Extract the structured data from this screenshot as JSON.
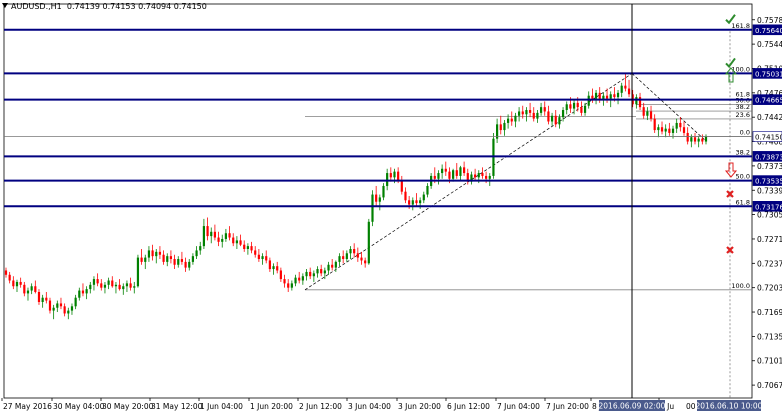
{
  "header": {
    "symbol": "AUDUSD.,H1",
    "ohlc": "0.74139 0.74153 0.74094 0.74150"
  },
  "colors": {
    "bull": "#008000",
    "bear": "#ff0000",
    "level_line": "#000080",
    "grid": "#000000",
    "cursor_label_bg": "#4a5a8c"
  },
  "cursor": {
    "x_label": "2016.06.09 02:00",
    "x_label_right": "2016.06.10 10:00"
  },
  "icons": [
    "check-icon",
    "check-icon",
    "up-arrow-icon",
    "down-arrow-icon",
    "cross-icon",
    "cross-icon"
  ],
  "chart_data": {
    "type": "candlestick",
    "ylim": [
      0.705,
      0.76
    ],
    "y_ticks": [
      "0.75780",
      "0.75440",
      "0.75100",
      "0.74760",
      "0.74420",
      "0.74080",
      "0.73730",
      "0.73390",
      "0.73050",
      "0.72710",
      "0.72370",
      "0.72030",
      "0.71690",
      "0.71350",
      "0.71010",
      "0.70670"
    ],
    "x_ticks": [
      "27 May 2016",
      "30 May 04:00",
      "30 May 20:00",
      "31 May 12:00",
      "1 Jun 04:00",
      "1 Jun 20:00",
      "2 Jun 12:00",
      "3 Jun 04:00",
      "3 Jun 20:00",
      "6 Jun 12:00",
      "7 Jun 04:00",
      "7 Jun 20:00",
      "8 Ju",
      "9 Ju"
    ],
    "x_label_text": "00",
    "price_levels": [
      {
        "label": "0.75640",
        "value": 0.7564
      },
      {
        "label": "0.75031",
        "value": 0.75031
      },
      {
        "label": "0.74665",
        "value": 0.74665
      },
      {
        "label": "0.74150",
        "value": 0.7415
      },
      {
        "label": "0.73873",
        "value": 0.73873
      },
      {
        "label": "0.73535",
        "value": 0.73535
      },
      {
        "label": "0.73176",
        "value": 0.73176
      }
    ],
    "fibo_big": [
      {
        "label": "161.8",
        "value": 0.7564
      },
      {
        "label": "100.0",
        "value": 0.75031
      },
      {
        "label": "61.8",
        "value": 0.74665
      },
      {
        "label": "100.0",
        "value": 0.7201
      }
    ],
    "fibo_small": [
      {
        "label": "50.0",
        "value": 0.74595
      },
      {
        "label": "38.2",
        "value": 0.74505
      },
      {
        "label": "23.6",
        "value": 0.74395
      },
      {
        "label": "0.0",
        "value": 0.7415
      },
      {
        "label": "38.2",
        "value": 0.73873
      },
      {
        "label": "50.0",
        "value": 0.73535
      },
      {
        "label": "61.8",
        "value": 0.73176
      }
    ],
    "ohlc": [
      [
        0.7228,
        0.7232,
        0.7218,
        0.7222
      ],
      [
        0.7222,
        0.7226,
        0.721,
        0.7214
      ],
      [
        0.7214,
        0.722,
        0.7202,
        0.7206
      ],
      [
        0.7206,
        0.7215,
        0.7198,
        0.7212
      ],
      [
        0.7212,
        0.7218,
        0.7204,
        0.7208
      ],
      [
        0.7208,
        0.7212,
        0.7192,
        0.7196
      ],
      [
        0.7196,
        0.7204,
        0.7186,
        0.72
      ],
      [
        0.72,
        0.721,
        0.7195,
        0.7206
      ],
      [
        0.7206,
        0.7214,
        0.7196,
        0.7198
      ],
      [
        0.7198,
        0.7202,
        0.718,
        0.7184
      ],
      [
        0.7184,
        0.7194,
        0.7176,
        0.719
      ],
      [
        0.719,
        0.7198,
        0.7182,
        0.7186
      ],
      [
        0.7186,
        0.719,
        0.7168,
        0.7172
      ],
      [
        0.7172,
        0.718,
        0.716,
        0.7176
      ],
      [
        0.7176,
        0.7186,
        0.717,
        0.7182
      ],
      [
        0.7182,
        0.719,
        0.7174,
        0.7178
      ],
      [
        0.7178,
        0.7182,
        0.7164,
        0.7168
      ],
      [
        0.7168,
        0.7176,
        0.716,
        0.7172
      ],
      [
        0.7172,
        0.7182,
        0.7166,
        0.7178
      ],
      [
        0.7178,
        0.7194,
        0.7174,
        0.719
      ],
      [
        0.719,
        0.7204,
        0.7186,
        0.72
      ],
      [
        0.72,
        0.721,
        0.7192,
        0.7196
      ],
      [
        0.7196,
        0.7206,
        0.7188,
        0.7202
      ],
      [
        0.7202,
        0.7212,
        0.7196,
        0.7208
      ],
      [
        0.7208,
        0.722,
        0.72,
        0.7216
      ],
      [
        0.7216,
        0.7224,
        0.7206,
        0.721
      ],
      [
        0.721,
        0.7216,
        0.72,
        0.7204
      ],
      [
        0.7204,
        0.7212,
        0.7196,
        0.7208
      ],
      [
        0.7208,
        0.7218,
        0.7202,
        0.7214
      ],
      [
        0.7214,
        0.722,
        0.7204,
        0.7206
      ],
      [
        0.7206,
        0.7212,
        0.7196,
        0.7208
      ],
      [
        0.7208,
        0.7216,
        0.72,
        0.7202
      ],
      [
        0.7202,
        0.721,
        0.7194,
        0.7206
      ],
      [
        0.7206,
        0.7214,
        0.7198,
        0.721
      ],
      [
        0.721,
        0.7218,
        0.72,
        0.7204
      ],
      [
        0.7204,
        0.7212,
        0.7196,
        0.7206
      ],
      [
        0.7206,
        0.725,
        0.7204,
        0.7246
      ],
      [
        0.7246,
        0.7258,
        0.7236,
        0.724
      ],
      [
        0.724,
        0.725,
        0.723,
        0.7246
      ],
      [
        0.7246,
        0.7262,
        0.724,
        0.7256
      ],
      [
        0.7256,
        0.7264,
        0.7242,
        0.7248
      ],
      [
        0.7248,
        0.7258,
        0.7238,
        0.7254
      ],
      [
        0.7254,
        0.7262,
        0.7244,
        0.725
      ],
      [
        0.725,
        0.7256,
        0.7236,
        0.724
      ],
      [
        0.724,
        0.7252,
        0.7234,
        0.7248
      ],
      [
        0.7248,
        0.7256,
        0.7238,
        0.7244
      ],
      [
        0.7244,
        0.725,
        0.723,
        0.7236
      ],
      [
        0.7236,
        0.7248,
        0.7232,
        0.7244
      ],
      [
        0.7244,
        0.7254,
        0.7236,
        0.724
      ],
      [
        0.724,
        0.7246,
        0.7226,
        0.7232
      ],
      [
        0.7232,
        0.7244,
        0.7228,
        0.724
      ],
      [
        0.724,
        0.7252,
        0.7236,
        0.7248
      ],
      [
        0.7248,
        0.7262,
        0.7244,
        0.7256
      ],
      [
        0.7256,
        0.7268,
        0.725,
        0.7262
      ],
      [
        0.7262,
        0.73,
        0.7258,
        0.729
      ],
      [
        0.729,
        0.7302,
        0.727,
        0.7276
      ],
      [
        0.7276,
        0.7288,
        0.7266,
        0.7282
      ],
      [
        0.7282,
        0.7292,
        0.727,
        0.7274
      ],
      [
        0.7274,
        0.7282,
        0.7262,
        0.7268
      ],
      [
        0.7268,
        0.7278,
        0.726,
        0.7272
      ],
      [
        0.7272,
        0.7286,
        0.7268,
        0.728
      ],
      [
        0.728,
        0.729,
        0.727,
        0.7274
      ],
      [
        0.7274,
        0.728,
        0.7262,
        0.7266
      ],
      [
        0.7266,
        0.7276,
        0.7258,
        0.727
      ],
      [
        0.727,
        0.7278,
        0.7262,
        0.7264
      ],
      [
        0.7264,
        0.727,
        0.7254,
        0.7258
      ],
      [
        0.7258,
        0.7266,
        0.725,
        0.7262
      ],
      [
        0.7262,
        0.7268,
        0.7252,
        0.7256
      ],
      [
        0.7256,
        0.7262,
        0.7246,
        0.725
      ],
      [
        0.725,
        0.7258,
        0.724,
        0.7244
      ],
      [
        0.7244,
        0.7252,
        0.7236,
        0.7248
      ],
      [
        0.7248,
        0.7256,
        0.7238,
        0.7242
      ],
      [
        0.7242,
        0.7246,
        0.7226,
        0.723
      ],
      [
        0.723,
        0.7238,
        0.7222,
        0.7234
      ],
      [
        0.7234,
        0.724,
        0.7224,
        0.7228
      ],
      [
        0.7228,
        0.7232,
        0.7212,
        0.7216
      ],
      [
        0.7216,
        0.7222,
        0.7204,
        0.721
      ],
      [
        0.721,
        0.7216,
        0.7198,
        0.7204
      ],
      [
        0.7204,
        0.7214,
        0.72,
        0.721
      ],
      [
        0.721,
        0.7222,
        0.7206,
        0.7218
      ],
      [
        0.7218,
        0.7226,
        0.721,
        0.7214
      ],
      [
        0.7214,
        0.7224,
        0.7208,
        0.722
      ],
      [
        0.722,
        0.723,
        0.7214,
        0.7226
      ],
      [
        0.7226,
        0.7232,
        0.7216,
        0.722
      ],
      [
        0.722,
        0.7228,
        0.7212,
        0.7224
      ],
      [
        0.7224,
        0.7234,
        0.7218,
        0.723
      ],
      [
        0.723,
        0.7236,
        0.722,
        0.7224
      ],
      [
        0.7224,
        0.7232,
        0.7216,
        0.7228
      ],
      [
        0.7228,
        0.724,
        0.7222,
        0.7236
      ],
      [
        0.7236,
        0.7244,
        0.7228,
        0.7232
      ],
      [
        0.7232,
        0.7242,
        0.7226,
        0.724
      ],
      [
        0.724,
        0.7252,
        0.7234,
        0.7248
      ],
      [
        0.7248,
        0.7256,
        0.7238,
        0.7244
      ],
      [
        0.7244,
        0.7256,
        0.724,
        0.7252
      ],
      [
        0.7252,
        0.7262,
        0.7244,
        0.7258
      ],
      [
        0.7258,
        0.7266,
        0.7246,
        0.7252
      ],
      [
        0.7252,
        0.726,
        0.724,
        0.7246
      ],
      [
        0.7246,
        0.7254,
        0.7236,
        0.7242
      ],
      [
        0.7242,
        0.7246,
        0.7232,
        0.7238
      ],
      [
        0.7238,
        0.73,
        0.7236,
        0.7296
      ],
      [
        0.7296,
        0.734,
        0.729,
        0.7334
      ],
      [
        0.7334,
        0.7346,
        0.7318,
        0.7324
      ],
      [
        0.7324,
        0.7334,
        0.7312,
        0.733
      ],
      [
        0.733,
        0.735,
        0.7326,
        0.7346
      ],
      [
        0.7346,
        0.737,
        0.734,
        0.7364
      ],
      [
        0.7364,
        0.7372,
        0.7352,
        0.7358
      ],
      [
        0.7358,
        0.737,
        0.735,
        0.7366
      ],
      [
        0.7366,
        0.7372,
        0.735,
        0.7354
      ],
      [
        0.7354,
        0.736,
        0.7334,
        0.7338
      ],
      [
        0.7338,
        0.7344,
        0.7322,
        0.7326
      ],
      [
        0.7326,
        0.7332,
        0.7314,
        0.732
      ],
      [
        0.732,
        0.733,
        0.7312,
        0.7326
      ],
      [
        0.7326,
        0.7336,
        0.7318,
        0.7322
      ],
      [
        0.7322,
        0.733,
        0.7314,
        0.7326
      ],
      [
        0.7326,
        0.7338,
        0.7322,
        0.7334
      ],
      [
        0.7334,
        0.735,
        0.733,
        0.7346
      ],
      [
        0.7346,
        0.7364,
        0.7342,
        0.736
      ],
      [
        0.736,
        0.7372,
        0.735,
        0.7356
      ],
      [
        0.7356,
        0.7368,
        0.7348,
        0.7364
      ],
      [
        0.7364,
        0.7376,
        0.7356,
        0.737
      ],
      [
        0.737,
        0.738,
        0.736,
        0.7366
      ],
      [
        0.7366,
        0.7372,
        0.735,
        0.7356
      ],
      [
        0.7356,
        0.737,
        0.7352,
        0.7368
      ],
      [
        0.7368,
        0.7378,
        0.7356,
        0.736
      ],
      [
        0.736,
        0.7374,
        0.7354,
        0.7372
      ],
      [
        0.7372,
        0.738,
        0.736,
        0.7364
      ],
      [
        0.7364,
        0.737,
        0.7348,
        0.7352
      ],
      [
        0.7352,
        0.7366,
        0.7348,
        0.7362
      ],
      [
        0.7362,
        0.737,
        0.7354,
        0.7358
      ],
      [
        0.7358,
        0.7368,
        0.735,
        0.7364
      ],
      [
        0.7364,
        0.7372,
        0.7356,
        0.736
      ],
      [
        0.736,
        0.7366,
        0.735,
        0.7356
      ],
      [
        0.7356,
        0.7364,
        0.7346,
        0.736
      ],
      [
        0.736,
        0.742,
        0.7356,
        0.7412
      ],
      [
        0.7412,
        0.744,
        0.7406,
        0.7432
      ],
      [
        0.7432,
        0.7444,
        0.7418,
        0.7424
      ],
      [
        0.7424,
        0.7438,
        0.7416,
        0.7434
      ],
      [
        0.7434,
        0.7446,
        0.7426,
        0.744
      ],
      [
        0.744,
        0.745,
        0.743,
        0.7436
      ],
      [
        0.7436,
        0.7448,
        0.7428,
        0.7444
      ],
      [
        0.7444,
        0.7456,
        0.7436,
        0.745
      ],
      [
        0.745,
        0.7458,
        0.744,
        0.7446
      ],
      [
        0.7446,
        0.7456,
        0.7436,
        0.7452
      ],
      [
        0.7452,
        0.7462,
        0.7442,
        0.7448
      ],
      [
        0.7448,
        0.7456,
        0.7436,
        0.744
      ],
      [
        0.744,
        0.7452,
        0.7434,
        0.7448
      ],
      [
        0.7448,
        0.7462,
        0.7444,
        0.7456
      ],
      [
        0.7456,
        0.7464,
        0.7444,
        0.745
      ],
      [
        0.745,
        0.7458,
        0.7432,
        0.7436
      ],
      [
        0.7436,
        0.7448,
        0.743,
        0.7444
      ],
      [
        0.7444,
        0.7452,
        0.7428,
        0.7432
      ],
      [
        0.7432,
        0.7446,
        0.7426,
        0.7442
      ],
      [
        0.7442,
        0.7456,
        0.7436,
        0.7452
      ],
      [
        0.7452,
        0.7464,
        0.7446,
        0.746
      ],
      [
        0.746,
        0.747,
        0.7448,
        0.7454
      ],
      [
        0.7454,
        0.7466,
        0.7446,
        0.7462
      ],
      [
        0.7462,
        0.747,
        0.745,
        0.7456
      ],
      [
        0.7456,
        0.7464,
        0.7444,
        0.7448
      ],
      [
        0.7448,
        0.7462,
        0.7444,
        0.7458
      ],
      [
        0.7458,
        0.7478,
        0.7454,
        0.7472
      ],
      [
        0.7472,
        0.7482,
        0.7462,
        0.7468
      ],
      [
        0.7468,
        0.748,
        0.746,
        0.7476
      ],
      [
        0.7476,
        0.7484,
        0.7462,
        0.7466
      ],
      [
        0.7466,
        0.7476,
        0.7458,
        0.7472
      ],
      [
        0.7472,
        0.7482,
        0.7462,
        0.7468
      ],
      [
        0.7468,
        0.7478,
        0.7456,
        0.7474
      ],
      [
        0.7474,
        0.7484,
        0.7464,
        0.747
      ],
      [
        0.747,
        0.748,
        0.746,
        0.7476
      ],
      [
        0.7476,
        0.749,
        0.747,
        0.7486
      ],
      [
        0.7486,
        0.7503,
        0.7478,
        0.7482
      ],
      [
        0.7482,
        0.7494,
        0.747,
        0.7474
      ],
      [
        0.7474,
        0.748,
        0.7456,
        0.746
      ],
      [
        0.746,
        0.7474,
        0.7454,
        0.747
      ],
      [
        0.747,
        0.7476,
        0.7452,
        0.7456
      ],
      [
        0.7456,
        0.7462,
        0.744,
        0.7444
      ],
      [
        0.7444,
        0.7456,
        0.7438,
        0.745
      ],
      [
        0.745,
        0.7458,
        0.7436,
        0.744
      ],
      [
        0.744,
        0.7446,
        0.742,
        0.7424
      ],
      [
        0.7424,
        0.7432,
        0.7414,
        0.7428
      ],
      [
        0.7428,
        0.7436,
        0.7418,
        0.7422
      ],
      [
        0.7422,
        0.7432,
        0.7414,
        0.7426
      ],
      [
        0.7426,
        0.7434,
        0.7416,
        0.742
      ],
      [
        0.742,
        0.743,
        0.7412,
        0.7426
      ],
      [
        0.7426,
        0.744,
        0.742,
        0.7434
      ],
      [
        0.7434,
        0.7442,
        0.7422,
        0.7428
      ],
      [
        0.7428,
        0.7436,
        0.7416,
        0.742
      ],
      [
        0.742,
        0.7428,
        0.7404,
        0.7408
      ],
      [
        0.7408,
        0.7418,
        0.74,
        0.7414
      ],
      [
        0.7414,
        0.742,
        0.7404,
        0.7408
      ],
      [
        0.7408,
        0.7416,
        0.74,
        0.7412
      ],
      [
        0.7412,
        0.7418,
        0.7404,
        0.7408
      ],
      [
        0.7408,
        0.7418,
        0.7404,
        0.7415
      ]
    ]
  }
}
